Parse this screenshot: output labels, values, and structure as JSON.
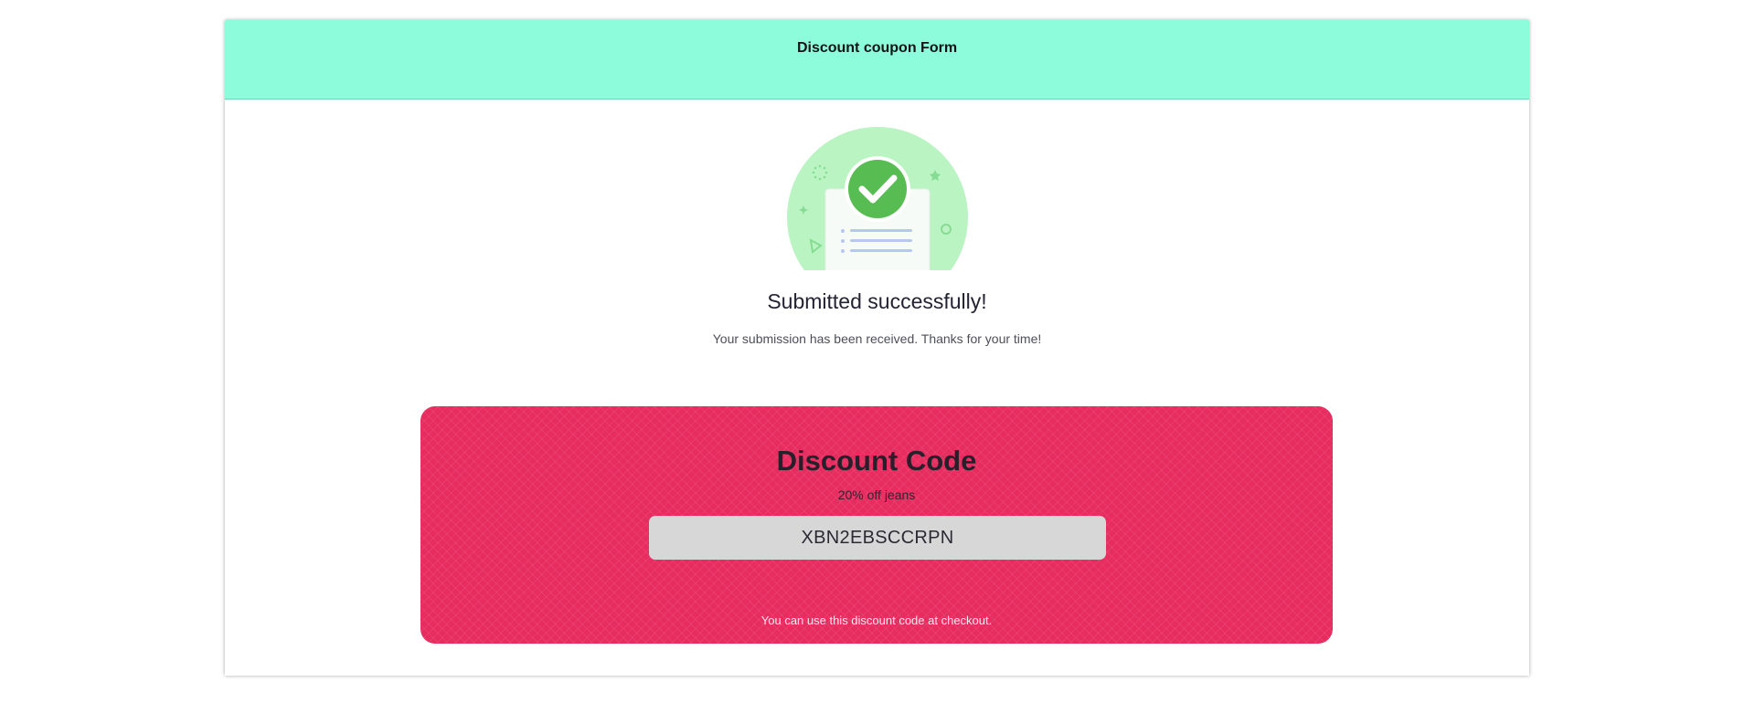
{
  "header": {
    "title": "Discount coupon Form"
  },
  "success": {
    "icon": "submission-success-illustration",
    "title": "Submitted successfully!",
    "message": "Your submission has been received. Thanks for your time!"
  },
  "coupon": {
    "title": "Discount Code",
    "description": "20% off jeans",
    "code": "XBN2EBSCCRPN",
    "note": "You can use this discount code at checkout.",
    "background_color": "#e72c60"
  },
  "colors": {
    "header_bg": "#8dfcdb",
    "success_green": "#57bd52",
    "illustration_bg": "#b9f4c2"
  }
}
